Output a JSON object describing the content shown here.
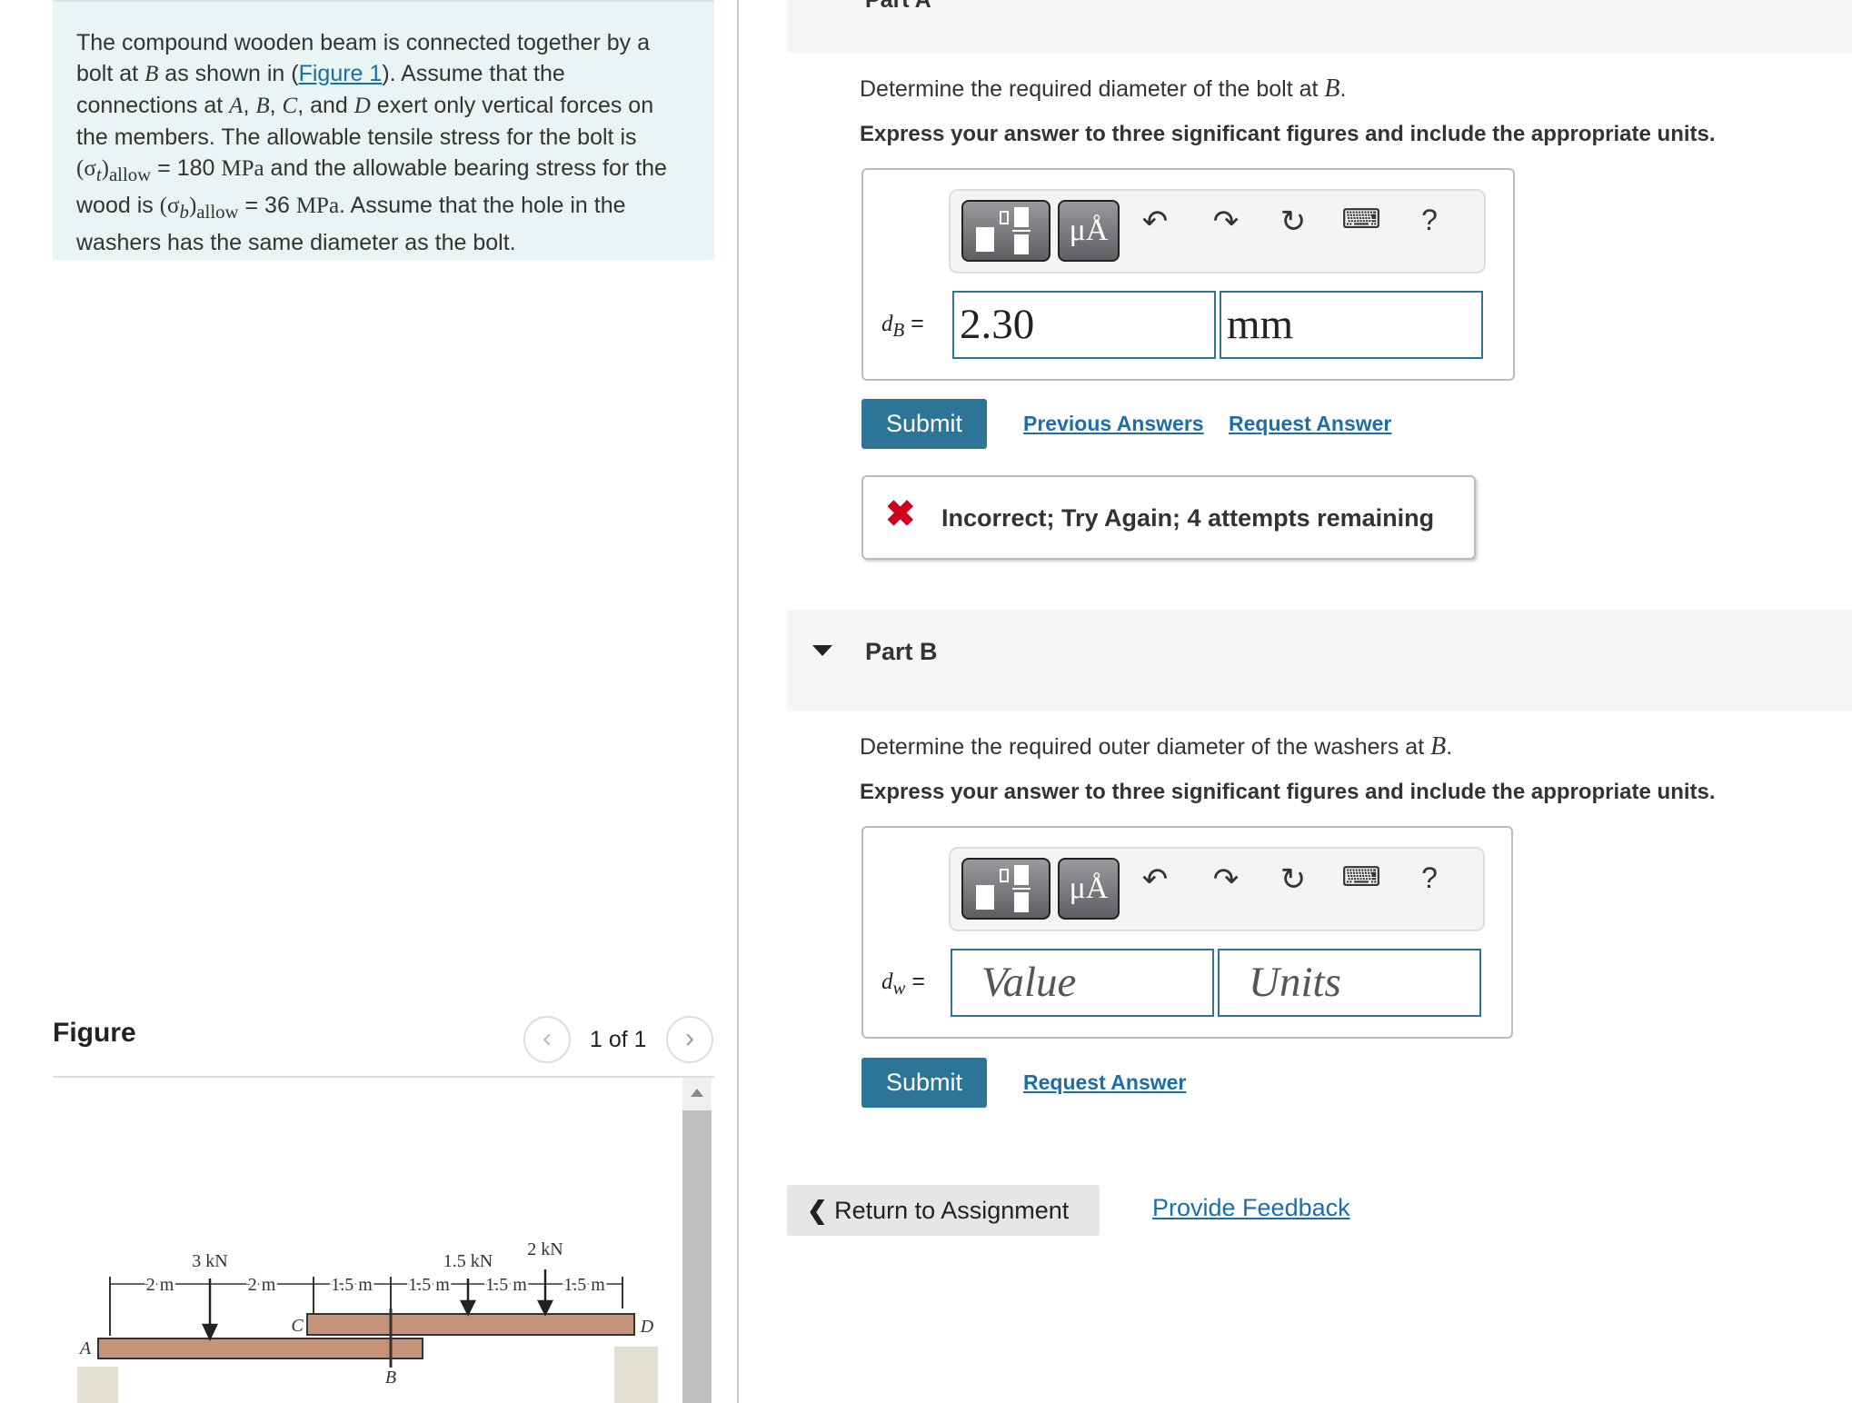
{
  "problem": {
    "t1": "The compound wooden beam is connected together by a bolt at ",
    "B": "B",
    "t2": " as shown in (",
    "figure_link": "Figure 1",
    "t3": "). Assume that the connections at ",
    "A": "A",
    "C": "C",
    "D": "D",
    "t4": ", and ",
    "t5": " exert only vertical forces on the members. The allowable tensile stress for the bolt is ",
    "sig_t": "(σ",
    "sub_t": "t",
    "allow": "allow",
    "t6": " = 180 ",
    "mpa": "MPa",
    "t7": " and the allowable bearing stress for the wood is ",
    "sig_b": "(σ",
    "sub_b": "b",
    "t8": " = 36 ",
    "t9": ". Assume that the hole in the washers has the same diameter as the bolt."
  },
  "figure": {
    "title": "Figure",
    "pager": "1 of 1",
    "loads": [
      "3 kN",
      "1.5 kN",
      "2 kN"
    ],
    "dims": [
      "2 m",
      "2 m",
      "1.5 m",
      "1.5 m",
      "1.5 m",
      "1.5 m"
    ],
    "points": [
      "A",
      "B",
      "C",
      "D"
    ]
  },
  "partA": {
    "title": "Part A",
    "prompt": "Determine the required diameter of the bolt at ",
    "var": "B",
    "instruction": "Express your answer to three significant figures and include the appropriate units.",
    "label_d": "d",
    "label_sub": "B",
    "value": "2.30",
    "units": "mm",
    "submit": "Submit",
    "prev": "Previous Answers",
    "request": "Request Answer",
    "feedback": "Incorrect; Try Again; 4 attempts remaining"
  },
  "partB": {
    "title": "Part B",
    "prompt": "Determine the required outer diameter of the washers at ",
    "var": "B",
    "instruction": "Express your answer to three significant figures and include the appropriate units.",
    "label_d": "d",
    "label_sub": "w",
    "value_ph": "Value",
    "units_ph": "Units",
    "submit": "Submit",
    "request": "Request Answer"
  },
  "toolbar": {
    "units": "μÅ",
    "help": "?"
  },
  "footer": {
    "return": "Return to Assignment",
    "feedback": "Provide Feedback"
  },
  "colors": {
    "accent": "#2d7596",
    "error": "#d0021b",
    "link": "#1a6fa8"
  }
}
